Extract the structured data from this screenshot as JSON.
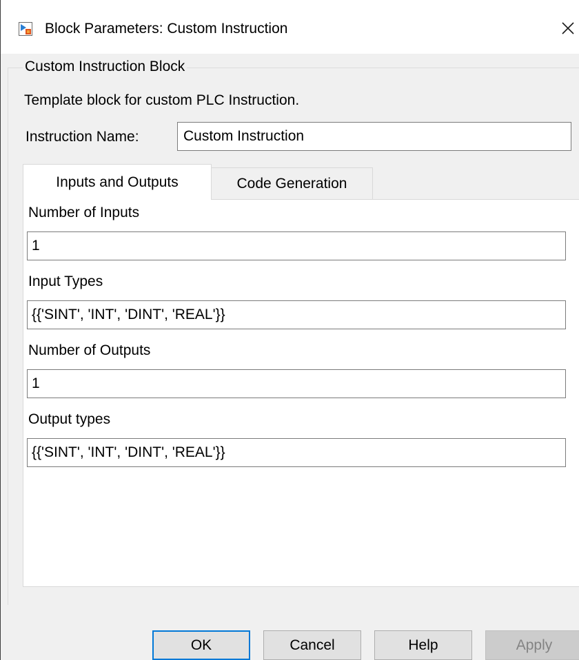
{
  "window": {
    "title": "Block Parameters: Custom Instruction"
  },
  "group": {
    "title": "Custom Instruction Block",
    "description": "Template block for custom PLC Instruction."
  },
  "instruction_name": {
    "label": "Instruction Name:",
    "value": "Custom Instruction"
  },
  "tabs": [
    {
      "label": "Inputs and Outputs",
      "active": true
    },
    {
      "label": "Code Generation",
      "active": false
    }
  ],
  "fields": {
    "num_inputs": {
      "label": "Number of Inputs",
      "value": "1"
    },
    "input_types": {
      "label": "Input Types",
      "value": "{{'SINT', 'INT', 'DINT', 'REAL'}}"
    },
    "num_outputs": {
      "label": "Number of Outputs",
      "value": "1"
    },
    "output_types": {
      "label": "Output types",
      "value": "{{'SINT', 'INT', 'DINT', 'REAL'}}"
    }
  },
  "buttons": {
    "ok": "OK",
    "cancel": "Cancel",
    "help": "Help",
    "apply": "Apply"
  },
  "icons": {
    "app": "simulink-block-icon",
    "close": "close-icon"
  },
  "colors": {
    "focus_border": "#0078d7",
    "disabled_text": "#838383"
  }
}
